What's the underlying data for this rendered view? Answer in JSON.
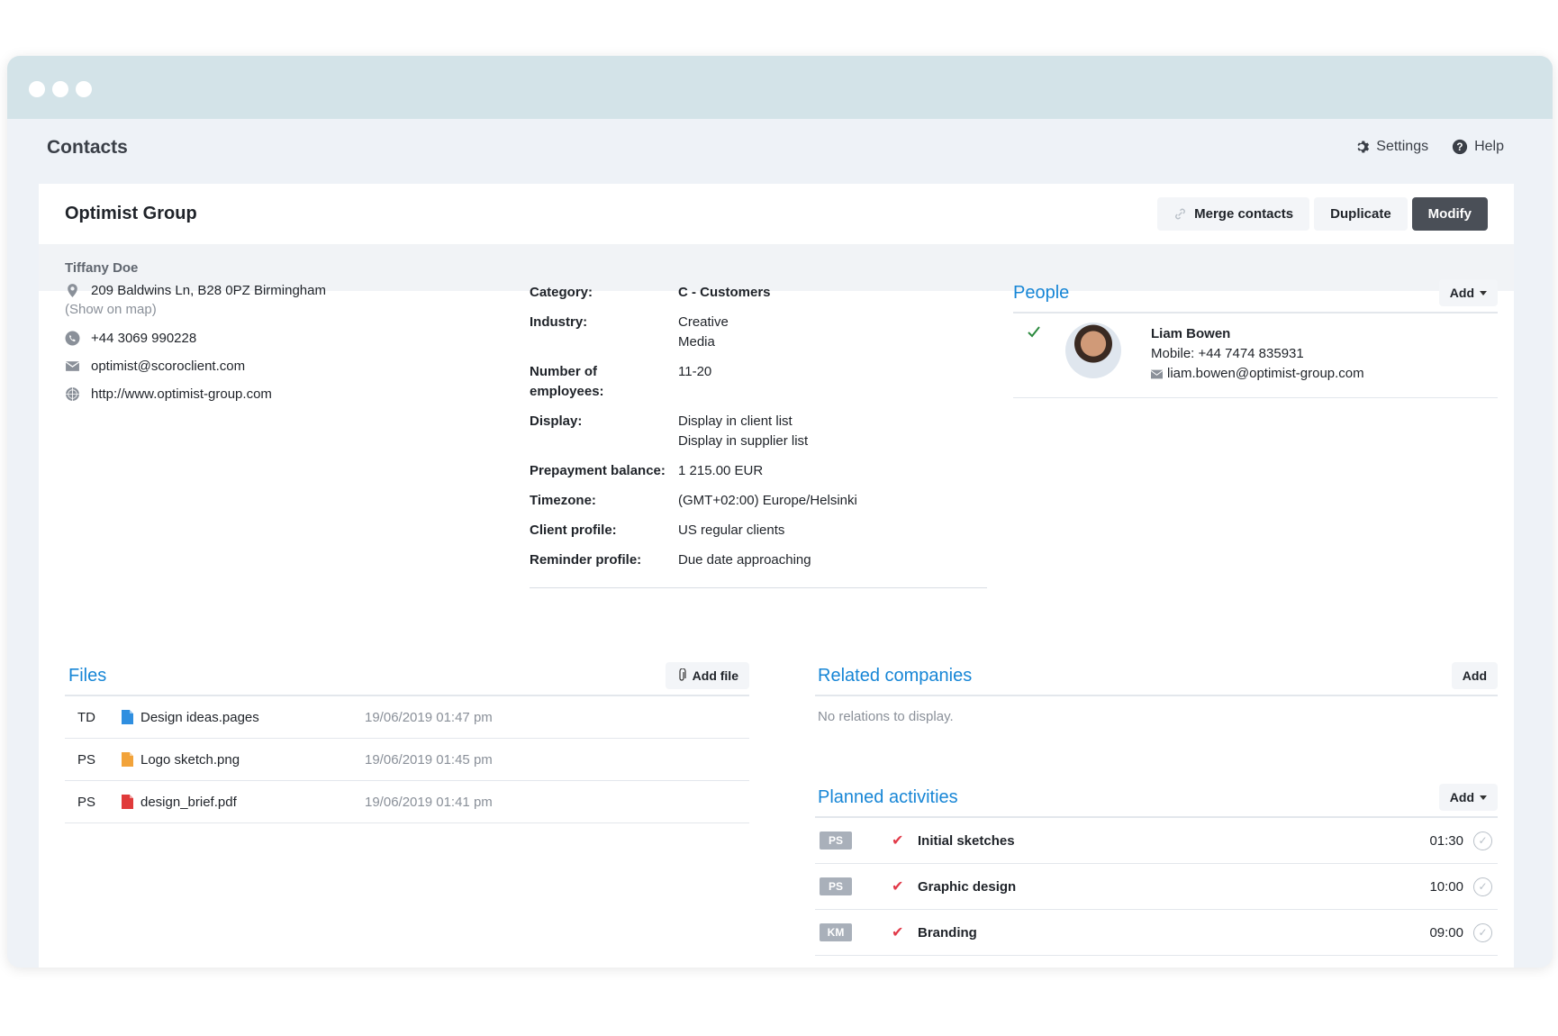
{
  "app": {
    "title": "Contacts",
    "settings_label": "Settings",
    "help_label": "Help"
  },
  "contact": {
    "company": "Optimist Group",
    "person": "Tiffany Doe",
    "actions": {
      "merge": "Merge contacts",
      "duplicate": "Duplicate",
      "modify": "Modify"
    },
    "address": "209 Baldwins Ln, B28 0PZ Birmingham",
    "show_map": "(Show on map)",
    "phone": "+44 3069 990228",
    "email": "optimist@scoroclient.com",
    "website": "http://www.optimist-group.com"
  },
  "details": [
    {
      "label": "Category:",
      "value": "C - Customers",
      "bold": true
    },
    {
      "label": "Industry:",
      "value": "Creative\nMedia"
    },
    {
      "label": "Number of\nemployees:",
      "value": "11-20"
    },
    {
      "label": "Display:",
      "value": "Display in client list\nDisplay in supplier list"
    },
    {
      "label": "Prepayment balance:",
      "value": "1 215.00 EUR"
    },
    {
      "label": "Timezone:",
      "value": "(GMT+02:00) Europe/Helsinki"
    },
    {
      "label": "Client profile:",
      "value": "US regular clients"
    },
    {
      "label": "Reminder profile:",
      "value": "Due date approaching"
    }
  ],
  "people": {
    "title": "People",
    "add_label": "Add",
    "items": [
      {
        "name": "Liam Bowen",
        "mobile": "Mobile: +44 7474 835931",
        "email": "liam.bowen@optimist-group.com"
      }
    ]
  },
  "files": {
    "title": "Files",
    "add_label": "Add file",
    "items": [
      {
        "initials": "TD",
        "name": "Design ideas.pages",
        "date": "19/06/2019 01:47 pm",
        "icon": "pages-file-icon",
        "color": "#2f8fe0"
      },
      {
        "initials": "PS",
        "name": "Logo sketch.png",
        "date": "19/06/2019 01:45 pm",
        "icon": "image-file-icon",
        "color": "#f2a33a"
      },
      {
        "initials": "PS",
        "name": "design_brief.pdf",
        "date": "19/06/2019 01:41 pm",
        "icon": "pdf-file-icon",
        "color": "#e03a3a"
      }
    ]
  },
  "related": {
    "title": "Related companies",
    "add_label": "Add",
    "empty": "No relations to display."
  },
  "planned": {
    "title": "Planned activities",
    "add_label": "Add",
    "items": [
      {
        "tag": "PS",
        "name": "Initial sketches",
        "time": "01:30"
      },
      {
        "tag": "PS",
        "name": "Graphic design",
        "time": "10:00"
      },
      {
        "tag": "KM",
        "name": "Branding",
        "time": "09:00"
      }
    ]
  }
}
